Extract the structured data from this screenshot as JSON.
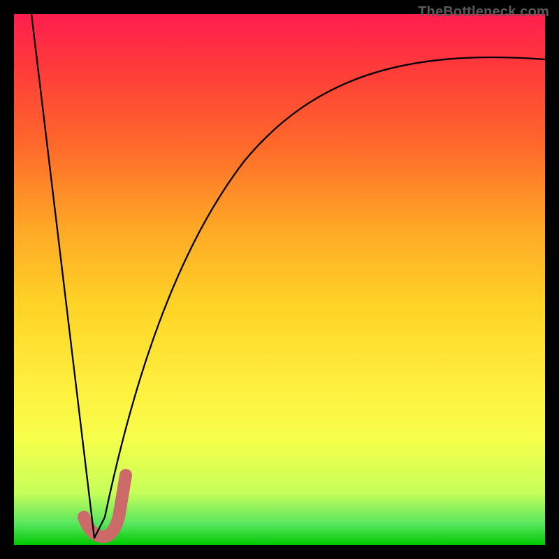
{
  "watermark": "TheBottleneck.com",
  "colors": {
    "curve": "#000000",
    "accent": "#cc6a6a",
    "gradient_top": "#ff1e4e",
    "gradient_bottom": "#00c800",
    "frame": "#000000"
  },
  "chart_data": {
    "type": "line",
    "title": "",
    "xlabel": "",
    "ylabel": "",
    "xlim": [
      0,
      100
    ],
    "ylim": [
      0,
      100
    ],
    "series": [
      {
        "name": "bottleneck-curve",
        "x": [
          0,
          5,
          10,
          13,
          15,
          17,
          20,
          25,
          30,
          35,
          40,
          50,
          60,
          70,
          80,
          90,
          100
        ],
        "y": [
          100,
          63,
          27,
          5,
          0,
          3,
          22,
          48,
          63,
          72,
          78,
          85,
          89,
          91,
          92.5,
          93,
          92
        ]
      }
    ],
    "accent_marker": {
      "shape": "J",
      "x": [
        13,
        15,
        17,
        19
      ],
      "y": [
        5,
        0,
        3,
        14
      ]
    }
  }
}
